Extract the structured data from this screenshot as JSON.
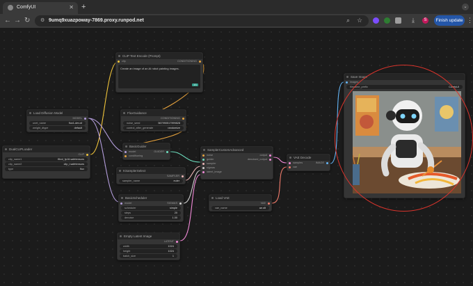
{
  "browser": {
    "tab_title": "ComfyUI",
    "tab_close": "✕",
    "new_tab": "+",
    "url": "9umq9xuazpoway-7869.proxy.runpod.net",
    "finish_update": "Finish update",
    "profile_initial": "S"
  },
  "nodes": {
    "clip_text_encode": {
      "title": "CLIP Text Encode (Prompt)",
      "in_clip": "clip",
      "out_conditioning": "CONDITIONING",
      "text": "Create an image of an AI robot painting images.",
      "tag": "1/1"
    },
    "load_diffusion": {
      "title": "Load Diffusion Model",
      "out_model": "MODEL",
      "w1_k": "unet_name",
      "w1_v": "flux1-dev.sf",
      "w2_k": "weight_dtype",
      "w2_v": "default"
    },
    "dual_clip": {
      "title": "DualCLIPLoader",
      "out_clip": "CLIP",
      "w1_k": "clip_name1",
      "w1_v": "t5xxl_fp16.safetensors",
      "w2_k": "clip_name2",
      "w2_v": "clip_l.safetensors",
      "w3_k": "type",
      "w3_v": "flux"
    },
    "flux_guidance": {
      "title": "FluxGuidance",
      "in_conditioning": "conditioning",
      "out_conditioning": "CONDITIONING",
      "w1_k": "noise_seed",
      "w1_v": "567990517999828",
      "w2_k": "control_after_generate",
      "w2_v": "randomize"
    },
    "basic_guider": {
      "title": "BasicGuider",
      "in_model": "model",
      "in_conditioning": "conditioning",
      "out_guider": "GUIDER"
    },
    "sampler_custom": {
      "title": "SamplerCustomAdvanced",
      "in_noise": "noise",
      "in_guider": "guider",
      "in_sampler": "sampler",
      "in_sigmas": "sigmas",
      "in_latent": "latent_image",
      "out_output": "output",
      "out_denoised": "denoised_output"
    },
    "ksampler_select": {
      "title": "KSamplerSelect",
      "out_sampler": "SAMPLER",
      "w1_k": "sampler_name",
      "w1_v": "euler"
    },
    "basic_scheduler": {
      "title": "BasicScheduler",
      "in_model": "model",
      "out_sigmas": "SIGMAS",
      "w1_k": "scheduler",
      "w1_v": "simple",
      "w2_k": "steps",
      "w2_v": "20",
      "w3_k": "denoise",
      "w3_v": "1.00"
    },
    "vae_decode": {
      "title": "VAE Decode",
      "in_samples": "samples",
      "in_vae": "vae",
      "out_image": "IMAGE"
    },
    "load_vae": {
      "title": "Load VAE",
      "out_vae": "VAE",
      "w1_k": "vae_name",
      "w1_v": "ae.sft"
    },
    "empty_latent": {
      "title": "Empty Latent Image",
      "out_latent": "LATENT",
      "w1_k": "width",
      "w1_v": "1024",
      "w2_k": "height",
      "w2_v": "1024",
      "w3_k": "batch_size",
      "w3_v": "1"
    },
    "save_image": {
      "title": "Save Image",
      "in_images": "images",
      "w1_k": "filename_prefix",
      "w1_v": "ComfyUI"
    }
  },
  "colors": {
    "clip": "#f0c43a",
    "conditioning": "#e7a33e",
    "model": "#b39ddb",
    "latent": "#f28ad8",
    "vae": "#f07b6b",
    "image": "#64b5f6",
    "sampler": "#ecb4b4",
    "sigmas": "#cfcfcf",
    "guider": "#6ee0c0",
    "annotation": "#d8342c"
  }
}
